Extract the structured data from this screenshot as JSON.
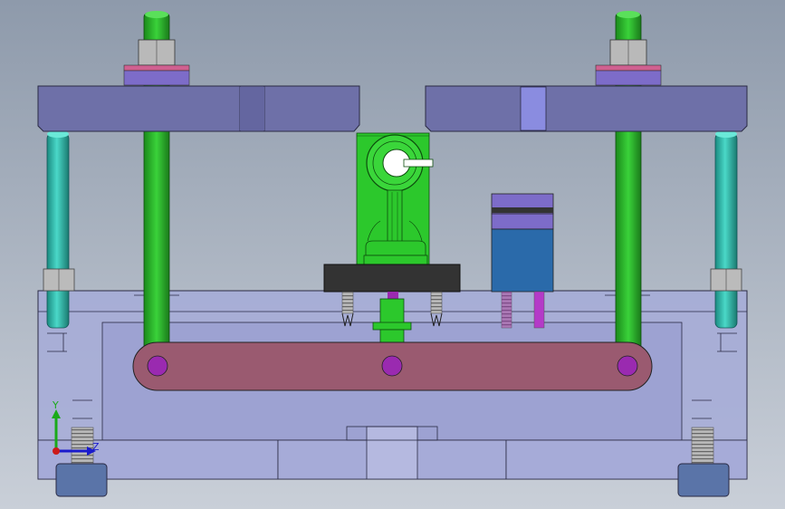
{
  "viewport": {
    "background_top": "#8e9aab",
    "background_bottom": "#c9cfd8"
  },
  "colors": {
    "plate": "#6e70a8",
    "plate_edge": "#2a2a44",
    "rod_green": "#2fbf2f",
    "rod_green_dark": "#1a7a1a",
    "guide_teal": "#2fb8a8",
    "nut_gray": "#b9b9b9",
    "washer_purple": "#7d6cc9",
    "washer_pink": "#d06090",
    "base_glass": "#9ea3cf",
    "link_bar": "#9a5a70",
    "pin_purple": "#9a2ab0",
    "block_blue": "#2a6aaa",
    "holder_black": "#333333",
    "foot_blue": "#5a74a8",
    "axis_x": "#1a1acc",
    "axis_y": "#1aaa1a",
    "axis_z": "#cc1a1a"
  },
  "triad": {
    "y_label": "Y",
    "z_label": "Z"
  }
}
